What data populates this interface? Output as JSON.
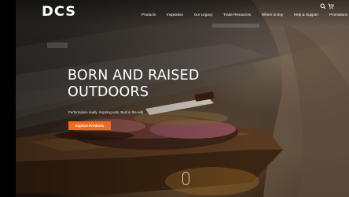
{
  "brand": {
    "logo_text": "DCS"
  },
  "nav": {
    "items": [
      {
        "label": "Products"
      },
      {
        "label": "Inspiration"
      },
      {
        "label": "Our Legacy"
      },
      {
        "label": "Trade Resources"
      },
      {
        "label": "Where to buy"
      },
      {
        "label": "Help & Support"
      },
      {
        "label": "Promotions"
      }
    ],
    "icons": [
      "search-icon",
      "cart-icon"
    ]
  },
  "hero": {
    "title_line1": "BORN AND RAISED",
    "title_line2": "OUTDOORS",
    "subtitle": "Performance ready. Inspiring eats. Built in the wild.",
    "cta_label": "Explore Products"
  },
  "colors": {
    "accent": "#f26a1b",
    "text": "#ffffff",
    "background": "#000000"
  }
}
